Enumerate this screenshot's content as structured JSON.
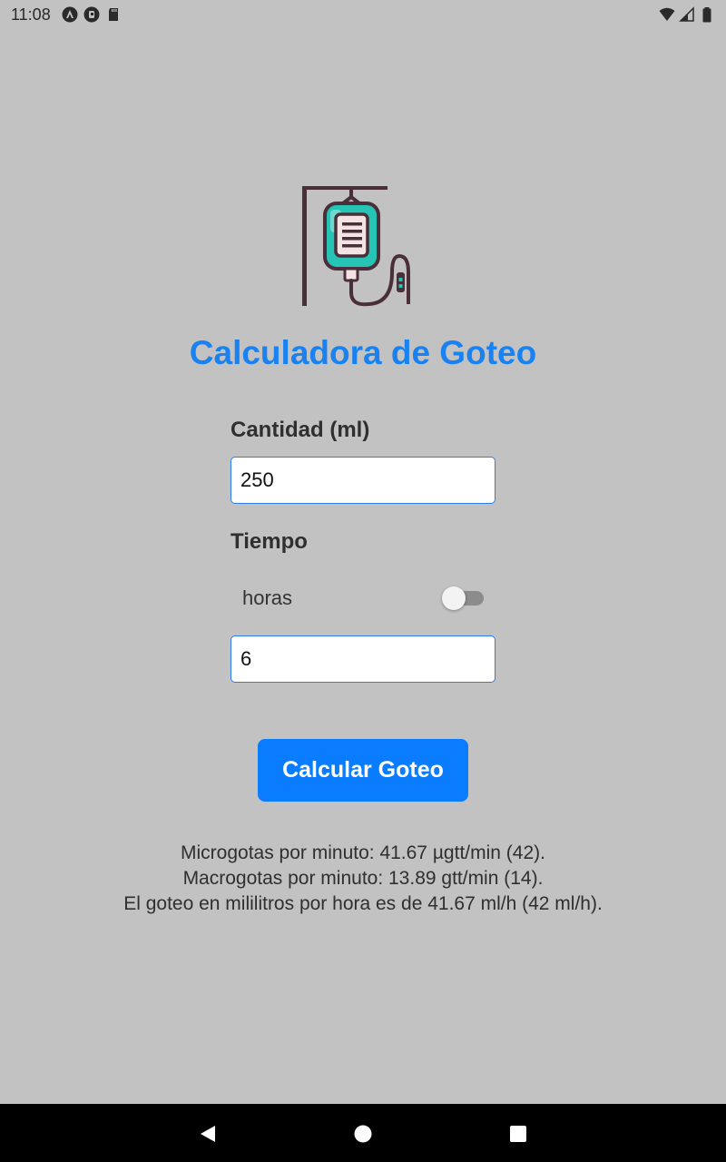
{
  "status_bar": {
    "time": "11:08",
    "left_icons": [
      "android-auto-icon",
      "app-notification-icon",
      "sd-card-icon"
    ],
    "right_icons": [
      "wifi-icon",
      "signal-icon",
      "battery-icon"
    ]
  },
  "app": {
    "logo_icon": "iv-drip-bag-icon",
    "title": "Calculadora de Goteo",
    "title_color": "#1a82f0"
  },
  "form": {
    "cantidad_label": "Cantidad (ml)",
    "cantidad_value": "250",
    "tiempo_label": "Tiempo",
    "unit_label": "horas",
    "unit_toggle_on": false,
    "tiempo_value": "6",
    "calc_button_label": "Calcular Goteo",
    "accent_color": "#0a7cff"
  },
  "results": {
    "micro": "Microgotas por minuto: 41.67 µgtt/min (42).",
    "macro": "Macrogotas por minuto: 13.89 gtt/min (14).",
    "ml_per_hour": "El goteo en mililitros por hora es de 41.67 ml/h (42 ml/h)."
  },
  "nav_bar": {
    "buttons": [
      "back-icon",
      "home-icon",
      "recents-icon"
    ]
  }
}
